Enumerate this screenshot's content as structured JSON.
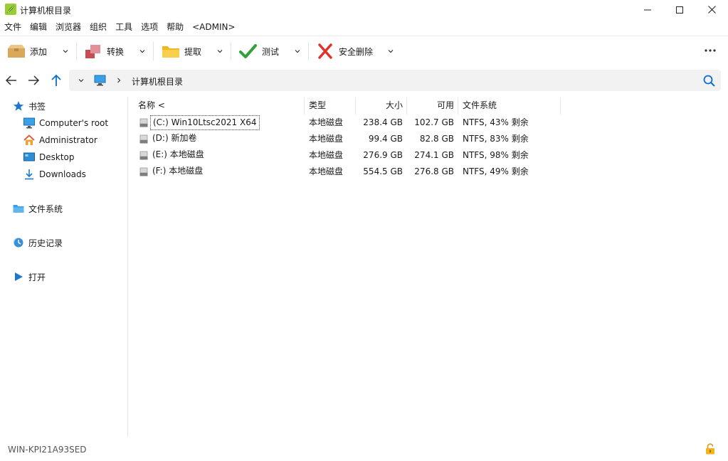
{
  "window": {
    "title": "计算机根目录"
  },
  "menu": [
    "文件",
    "编辑",
    "浏览器",
    "组织",
    "工具",
    "选项",
    "帮助",
    "<ADMIN>"
  ],
  "toolbar": {
    "buttons": [
      {
        "label": "添加",
        "icon": "add-archive-icon"
      },
      {
        "label": "转换",
        "icon": "convert-icon"
      },
      {
        "label": "提取",
        "icon": "extract-folder-icon"
      },
      {
        "label": "测试",
        "icon": "test-checkmark-icon"
      },
      {
        "label": "安全删除",
        "icon": "secure-delete-icon"
      }
    ],
    "more_icon": "more-icon"
  },
  "address": {
    "path": "计算机根目录"
  },
  "sidebar": {
    "bookmarks_label": "书签",
    "bookmarks": [
      {
        "label": "Computer's root",
        "icon": "computer-icon"
      },
      {
        "label": "Administrator",
        "icon": "home-icon"
      },
      {
        "label": "Desktop",
        "icon": "desktop-icon"
      },
      {
        "label": "Downloads",
        "icon": "download-icon"
      }
    ],
    "sections": [
      {
        "label": "文件系统",
        "icon": "folder-icon"
      },
      {
        "label": "历史记录",
        "icon": "history-icon"
      },
      {
        "label": "打开",
        "icon": "play-icon"
      }
    ]
  },
  "filelist": {
    "columns": {
      "name": "名称 <",
      "type": "类型",
      "size": "大小",
      "free": "可用",
      "fs": "文件系统"
    },
    "rows": [
      {
        "name": "(C:) Win10Ltsc2021 X64",
        "type": "本地磁盘",
        "size": "238.4 GB",
        "free": "102.7 GB",
        "fs": "NTFS, 43% 剩余"
      },
      {
        "name": "(D:) 新加卷",
        "type": "本地磁盘",
        "size": "99.4 GB",
        "free": "82.8 GB",
        "fs": "NTFS, 83% 剩余"
      },
      {
        "name": "(E:) 本地磁盘",
        "type": "本地磁盘",
        "size": "276.9 GB",
        "free": "274.1 GB",
        "fs": "NTFS, 98% 剩余"
      },
      {
        "name": "(F:) 本地磁盘",
        "type": "本地磁盘",
        "size": "554.5 GB",
        "free": "276.8 GB",
        "fs": "NTFS, 49% 剩余"
      }
    ]
  },
  "status": {
    "computer_name": "WIN-KPI21A93SED"
  },
  "colors": {
    "accent": "#0a6fd4",
    "delete_red": "#e0312b",
    "test_green": "#2ea13a",
    "folder_yellow": "#f5c32c"
  }
}
